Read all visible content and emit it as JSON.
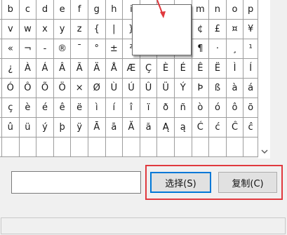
{
  "charmap": {
    "rows": [
      [
        "b",
        "c",
        "d",
        "e",
        "f",
        "g",
        "h",
        "i",
        "",
        "",
        "",
        "m",
        "n",
        "o",
        "p"
      ],
      [
        "v",
        "w",
        "x",
        "y",
        "z",
        "{",
        "|",
        "}",
        "",
        "",
        "",
        "¢",
        "£",
        "¤",
        "¥"
      ],
      [
        "«",
        "¬",
        "-",
        "®",
        "¯",
        "°",
        "±",
        "²",
        "",
        "",
        "",
        "¶",
        "·",
        "¸",
        "¹"
      ],
      [
        "¿",
        "À",
        "Á",
        "Â",
        "Ã",
        "Ä",
        "Å",
        "Æ",
        "Ç",
        "È",
        "É",
        "Ê",
        "Ë",
        "Ì",
        "Í"
      ],
      [
        "Ó",
        "Ô",
        "Õ",
        "Ö",
        "×",
        "Ø",
        "Ù",
        "Ú",
        "Û",
        "Ü",
        "Ý",
        "Þ",
        "ß",
        "à",
        "á"
      ],
      [
        "ç",
        "è",
        "é",
        "ê",
        "ë",
        "ì",
        "í",
        "î",
        "ï",
        "ð",
        "ñ",
        "ò",
        "ó",
        "ô",
        "õ"
      ],
      [
        "û",
        "ü",
        "ý",
        "þ",
        "ÿ",
        "Ā",
        "ā",
        "Ă",
        "ă",
        "Ą",
        "ą",
        "Ć",
        "ć",
        "Ĉ",
        "ĉ"
      ],
      [
        "",
        "",
        "",
        "",
        "",
        "",
        "",
        "",
        "",
        "",
        "",
        "",
        "",
        "",
        ""
      ]
    ]
  },
  "scrollbar": {
    "down_icon": "chevron-down-icon"
  },
  "characters_to_copy": {
    "value": ""
  },
  "buttons": {
    "select_label": "选择(S)",
    "copy_label": "复制(C)"
  },
  "colors": {
    "highlight": "#e0393e",
    "focus": "#0078d7"
  }
}
